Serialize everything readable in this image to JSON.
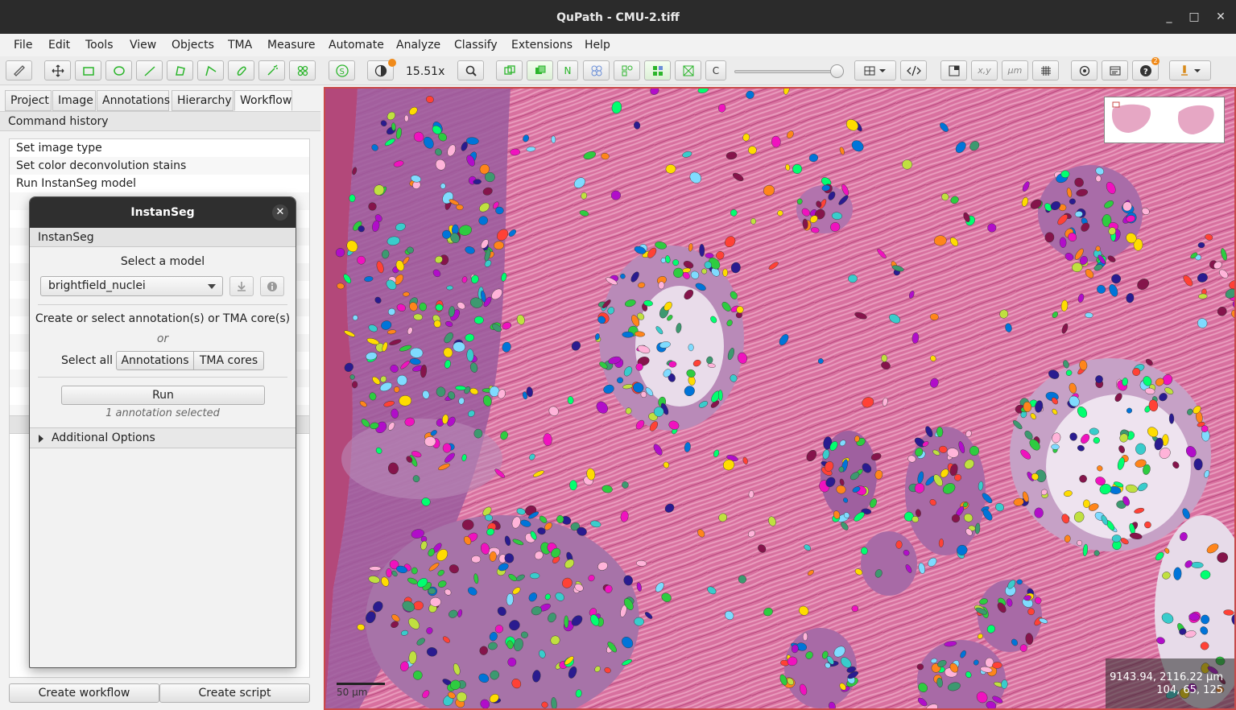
{
  "window": {
    "title": "QuPath - CMU-2.tiff",
    "minimize": "_",
    "maximize": "□",
    "close": "✕"
  },
  "menu": [
    "File",
    "Edit",
    "Tools",
    "View",
    "Objects",
    "TMA",
    "Measure",
    "Automate",
    "Analyze",
    "Classify",
    "Extensions",
    "Help"
  ],
  "toolbar": {
    "zoom": "15.51x",
    "n_label": "N",
    "c_label": "C",
    "xy_label": "x,y",
    "um_label": "µm",
    "help_badge": "2"
  },
  "tabs": [
    "Project",
    "Image",
    "Annotations",
    "Hierarchy",
    "Workflow"
  ],
  "active_tab": "Workflow",
  "command_history": {
    "header": "Command history",
    "items": [
      "Set image type",
      "Set color deconvolution stains",
      "Run InstanSeg model"
    ]
  },
  "bottom_buttons": {
    "create_workflow": "Create workflow",
    "create_script": "Create script"
  },
  "dialog": {
    "title": "InstanSeg",
    "section": "InstanSeg",
    "select_model_label": "Select a model",
    "model_value": "brightfield_nuclei",
    "instruction": "Create or select annotation(s) or TMA core(s)",
    "or_text": "or",
    "select_all_label": "Select all",
    "annotations_btn": "Annotations",
    "tma_btn": "TMA cores",
    "run_btn": "Run",
    "status": "1 annotation selected",
    "additional_options": "Additional Options"
  },
  "viewer": {
    "coords_line1": "9143.94, 2116.22 µm",
    "coords_line2": "104, 65, 125",
    "scalebar_label": "50 µm"
  },
  "colors": {
    "tissue": "#d46a9c",
    "accent_green": "#2bb52b",
    "titlebar": "#2b2b2b",
    "viewer_border": "#c94a4a"
  }
}
